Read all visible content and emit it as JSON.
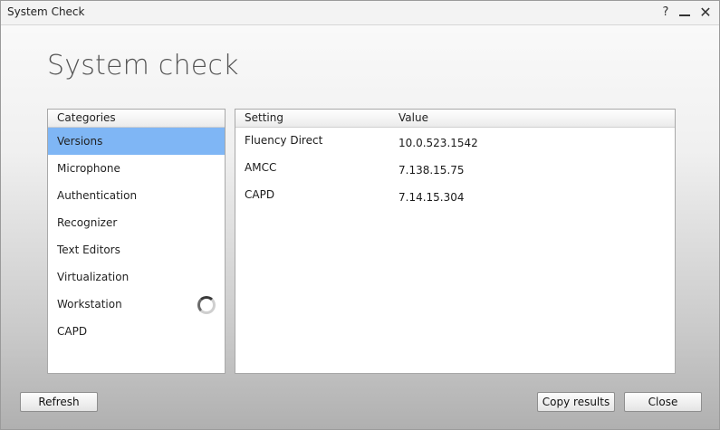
{
  "window": {
    "title": "System Check",
    "help_label": "?",
    "close_label": "✕"
  },
  "heading": "System check",
  "categories": {
    "header": "Categories",
    "items": [
      {
        "label": "Versions",
        "selected": true
      },
      {
        "label": "Microphone"
      },
      {
        "label": "Authentication"
      },
      {
        "label": "Recognizer"
      },
      {
        "label": "Text Editors"
      },
      {
        "label": "Virtualization"
      },
      {
        "label": "Workstation",
        "loading": true
      },
      {
        "label": "CAPD"
      }
    ]
  },
  "settings": {
    "columns": {
      "setting": "Setting",
      "value": "Value"
    },
    "rows": [
      {
        "setting": "Fluency Direct",
        "value": "10.0.523.1542"
      },
      {
        "setting": "AMCC",
        "value": "7.138.15.75"
      },
      {
        "setting": "CAPD",
        "value": "7.14.15.304"
      }
    ]
  },
  "buttons": {
    "refresh": "Refresh",
    "copy": "Copy results",
    "close": "Close"
  },
  "colors": {
    "selection": "#7fb6f5"
  }
}
